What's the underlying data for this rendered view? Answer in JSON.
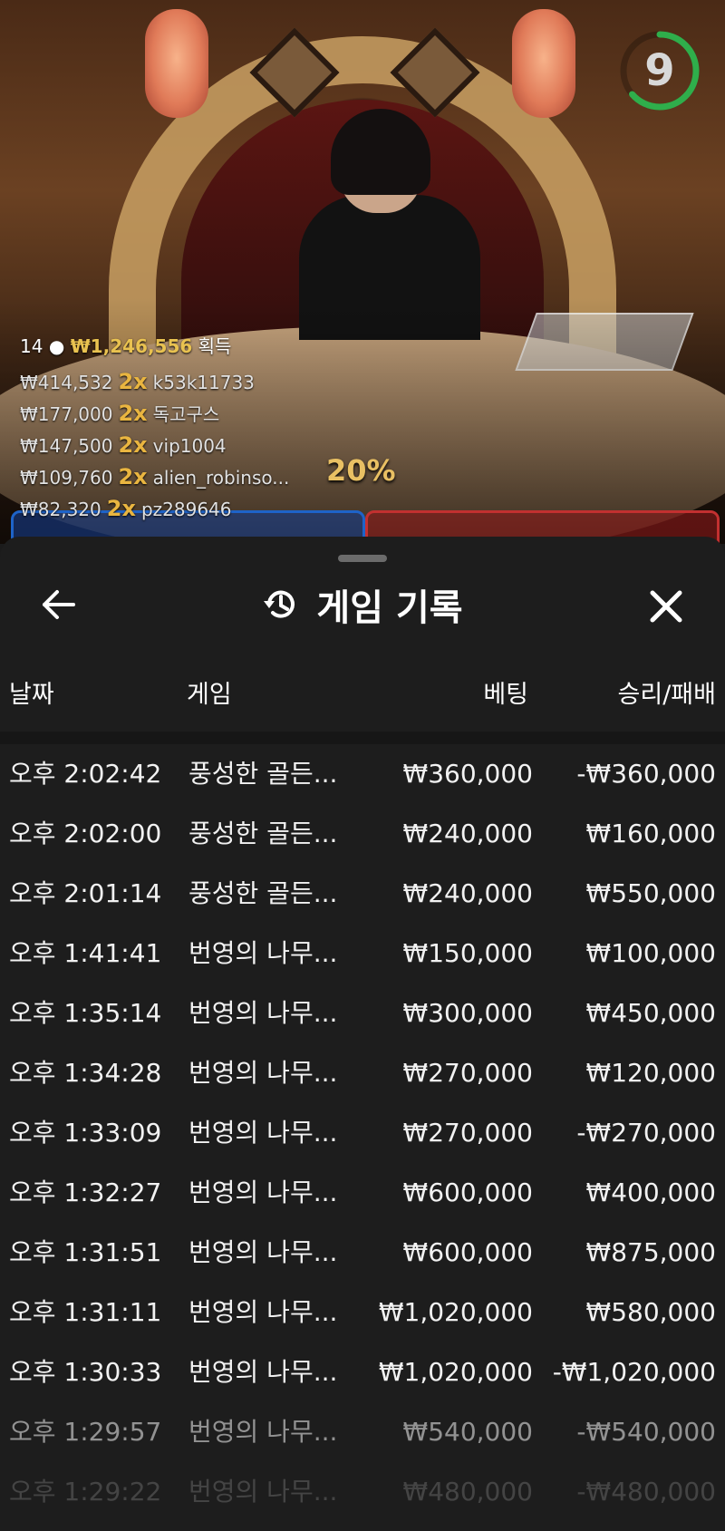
{
  "live": {
    "timer": "9",
    "winners_summary": {
      "count": "14",
      "amount": "₩1,246,556",
      "label": "획득"
    },
    "winners": [
      {
        "amount": "₩414,532",
        "mult": "2x",
        "name": "k53k11733"
      },
      {
        "amount": "₩177,000",
        "mult": "2x",
        "name": "독고구스"
      },
      {
        "amount": "₩147,500",
        "mult": "2x",
        "name": "vip1004"
      },
      {
        "amount": "₩109,760",
        "mult": "2x",
        "name": "alien_robinso..."
      },
      {
        "amount": "₩82,320",
        "mult": "2x",
        "name": "pz289646"
      }
    ],
    "percent": "20%",
    "colors": {
      "timer_ring": "#2fae4b",
      "gold": "#e9c250"
    }
  },
  "sheet": {
    "title": "게임 기록",
    "icons": {
      "back": "back-arrow-icon",
      "history": "history-icon",
      "close": "close-icon"
    },
    "columns": {
      "date": "날짜",
      "game": "게임",
      "bet": "베팅",
      "winloss": "승리/패배"
    },
    "rows": [
      {
        "time": "오후 2:02:42",
        "game": "풍성한 골든...",
        "bet": "₩360,000",
        "winloss": "-₩360,000"
      },
      {
        "time": "오후 2:02:00",
        "game": "풍성한 골든...",
        "bet": "₩240,000",
        "winloss": "₩160,000"
      },
      {
        "time": "오후 2:01:14",
        "game": "풍성한 골든...",
        "bet": "₩240,000",
        "winloss": "₩550,000"
      },
      {
        "time": "오후 1:41:41",
        "game": "번영의 나무...",
        "bet": "₩150,000",
        "winloss": "₩100,000"
      },
      {
        "time": "오후 1:35:14",
        "game": "번영의 나무...",
        "bet": "₩300,000",
        "winloss": "₩450,000"
      },
      {
        "time": "오후 1:34:28",
        "game": "번영의 나무...",
        "bet": "₩270,000",
        "winloss": "₩120,000"
      },
      {
        "time": "오후 1:33:09",
        "game": "번영의 나무...",
        "bet": "₩270,000",
        "winloss": "-₩270,000"
      },
      {
        "time": "오후 1:32:27",
        "game": "번영의 나무...",
        "bet": "₩600,000",
        "winloss": "₩400,000"
      },
      {
        "time": "오후 1:31:51",
        "game": "번영의 나무...",
        "bet": "₩600,000",
        "winloss": "₩875,000"
      },
      {
        "time": "오후 1:31:11",
        "game": "번영의 나무...",
        "bet": "₩1,020,000",
        "winloss": "₩580,000"
      },
      {
        "time": "오후 1:30:33",
        "game": "번영의 나무...",
        "bet": "₩1,020,000",
        "winloss": "-₩1,020,000"
      },
      {
        "time": "오후 1:29:57",
        "game": "번영의 나무...",
        "bet": "₩540,000",
        "winloss": "-₩540,000"
      },
      {
        "time": "오후 1:29:22",
        "game": "번영의 나무...",
        "bet": "₩480,000",
        "winloss": "-₩480,000"
      }
    ]
  }
}
